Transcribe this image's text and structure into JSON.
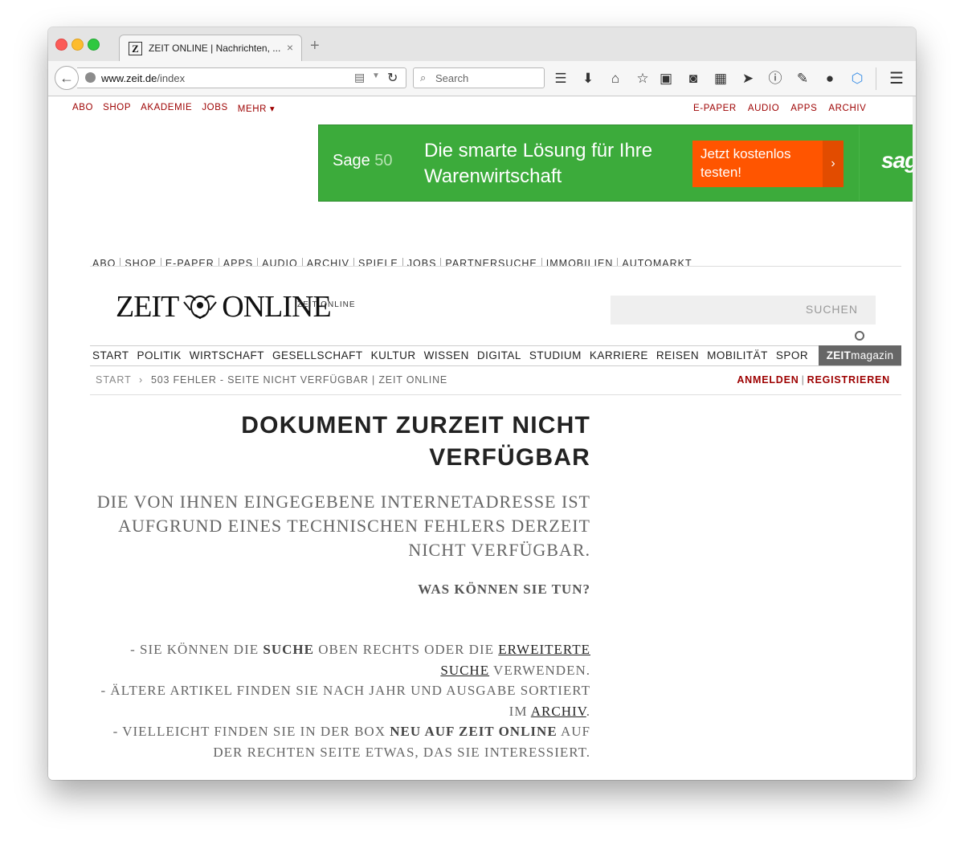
{
  "browser": {
    "tab_title": "ZEIT ONLINE | Nachrichten, ...",
    "tab_favicon": "Z",
    "tab_close": "×",
    "new_tab": "+",
    "url_host": "www.zeit.de",
    "url_path": "/index",
    "search_placeholder": "Search",
    "toolbar_icons": [
      "rss-icon",
      "download-icon",
      "home-icon",
      "bookmark-star-icon",
      "reading-list-icon",
      "pocket-icon",
      "apps-grid-icon",
      "send-icon",
      "info-icon",
      "wrench-icon",
      "chat-icon",
      "cube-icon"
    ]
  },
  "topnav": {
    "left": [
      "ABO",
      "SHOP",
      "AKADEMIE",
      "JOBS",
      "MEHR ▾"
    ],
    "right": [
      "E-PAPER",
      "AUDIO",
      "APPS",
      "ARCHIV"
    ]
  },
  "ad": {
    "brand_main": "Sage",
    "brand_num": "50",
    "headline": "Die smarte Lösung für Ihre Warenwirtschaft",
    "cta": "Jetzt kostenlos testen!",
    "cta_arrow": "›",
    "logo": "sag"
  },
  "secnav": [
    "ABO",
    "SHOP",
    "E-PAPER",
    "APPS",
    "AUDIO",
    "ARCHIV",
    "SPIELE",
    "JOBS",
    "PARTNERSUCHE",
    "IMMOBILIEN",
    "AUTOMARKT"
  ],
  "logo": {
    "left": "ZEIT",
    "right": "ONLINE",
    "overlay": "ZEIT ONLINE"
  },
  "search": {
    "label": "SUCHEN"
  },
  "mainnav": [
    "START",
    "POLITIK",
    "WIRTSCHAFT",
    "GESELLSCHAFT",
    "KULTUR",
    "WISSEN",
    "DIGITAL",
    "STUDIUM",
    "KARRIERE",
    "REISEN",
    "MOBILITÄT",
    "SPOR"
  ],
  "zeitmagazin": {
    "bold": "ZEIT",
    "rest": "magazin"
  },
  "breadcrumb": {
    "start": "START",
    "arrow": "›",
    "current": "503 FEHLER - SEITE NICHT VERFÜGBAR | ZEIT ONLINE",
    "login": "ANMELDEN",
    "separator": "|",
    "register": "REGISTRIEREN"
  },
  "article": {
    "title": "DOKUMENT ZURZEIT NICHT VERFÜGBAR",
    "lead": "DIE VON IHNEN EINGEGEBENE INTERNETADRESSE IST AUFGRUND EINES TECHNISCHEN FEHLERS DERZEIT NICHT VERFÜGBAR.",
    "subhead": "WAS KÖNNEN SIE TUN?",
    "line1_a": "- SIE KÖNNEN DIE ",
    "line1_bold": "SUCHE",
    "line1_b": " OBEN RECHTS ODER DIE ",
    "line1_link": "ERWEITERTE SUCHE",
    "line1_c": " VERWENDEN.",
    "line2_a": "- ÄLTERE ARTIKEL FINDEN SIE NACH JAHR UND AUSGABE SORTIERT IM ",
    "line2_link": "ARCHIV",
    "line2_b": ".",
    "line3_a": "- VIELLEICHT FINDEN SIE IN DER BOX ",
    "line3_bold": "NEU AUF ZEIT ONLINE",
    "line3_b": " AUF DER RECHTEN SEITE ETWAS, DAS SIE INTERESSIERT."
  },
  "colors": {
    "accent_red": "#9d0000",
    "ad_green": "#3cab3b",
    "ad_orange": "#ff5500",
    "zeitmagazin_bg": "#666666"
  }
}
